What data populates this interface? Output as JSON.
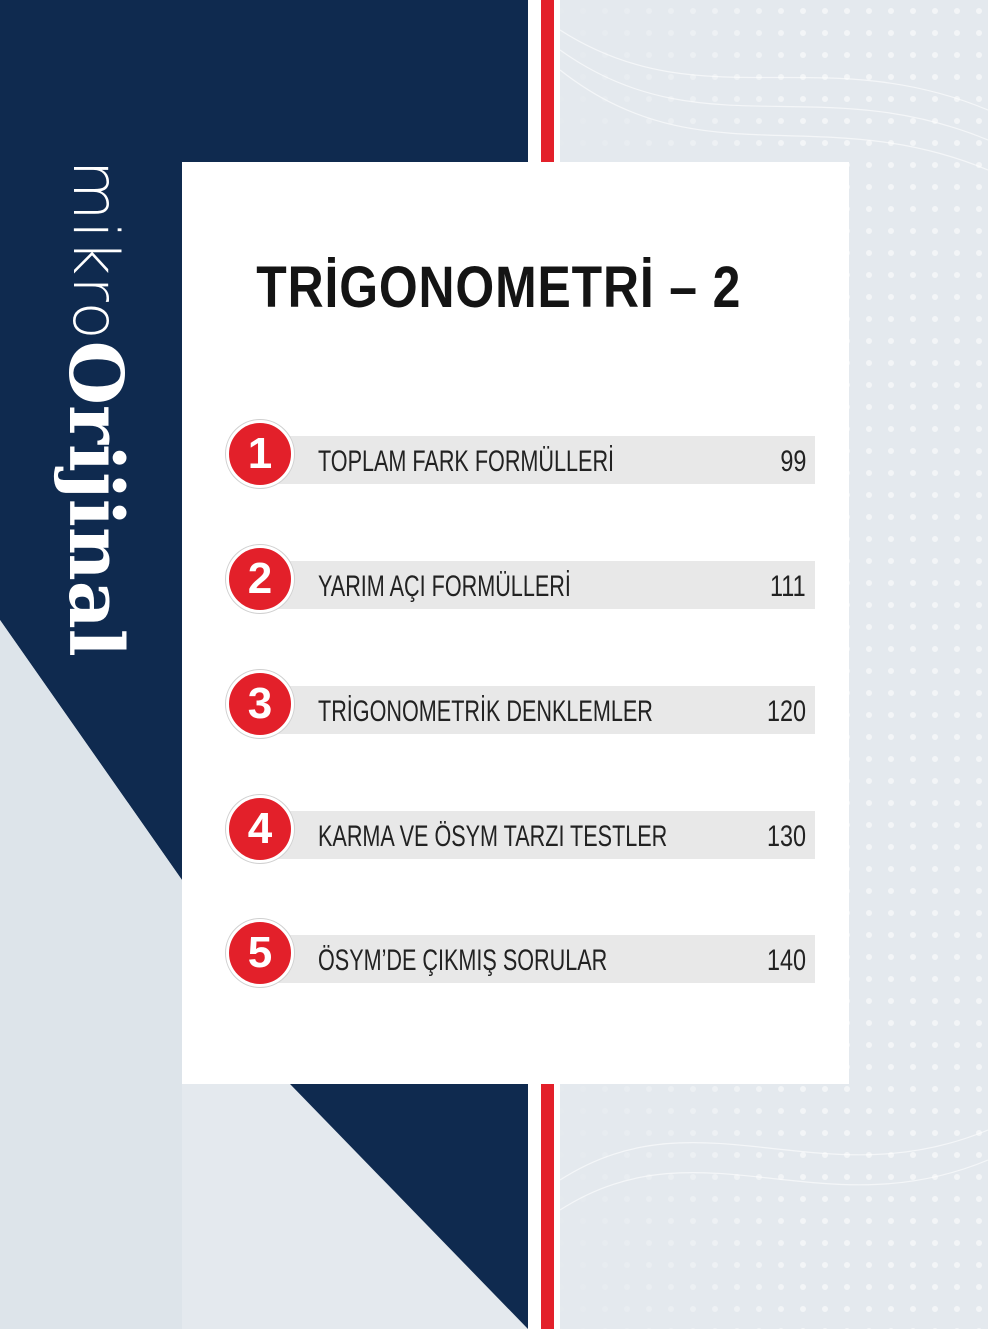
{
  "brand": {
    "mikro": "mikro",
    "orijinal": "Orijinal"
  },
  "title": "TRİGONOMETRİ – 2",
  "toc": [
    {
      "num": "1",
      "label": "TOPLAM FARK FORMÜLLERİ",
      "page": "99"
    },
    {
      "num": "2",
      "label": "YARIM AÇI FORMÜLLERİ",
      "page": "111"
    },
    {
      "num": "3",
      "label": "TRİGONOMETRİK DENKLEMLER",
      "page": "120"
    },
    {
      "num": "4",
      "label": "KARMA VE ÖSYM TARZI TESTLER",
      "page": "130"
    },
    {
      "num": "5",
      "label": "ÖSYM’DE ÇIKMIŞ SORULAR",
      "page": "140"
    }
  ],
  "colors": {
    "navy": "#0f2a4f",
    "red": "#e3202a",
    "light": "#e4e9ee",
    "bar": "#e8e8e8"
  }
}
